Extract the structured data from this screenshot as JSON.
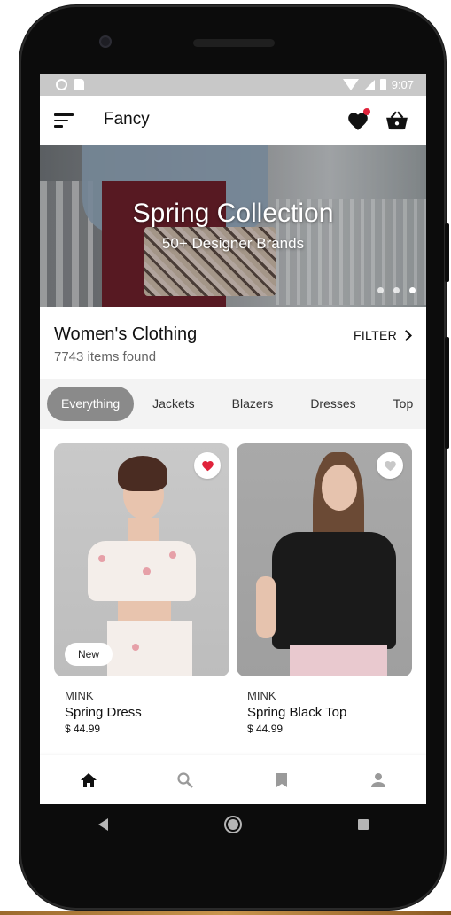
{
  "status_bar": {
    "time": "9:07"
  },
  "app_bar": {
    "title": "Fancy",
    "menu_icon": "menu-icon",
    "favorites_icon": "heart-icon",
    "cart_icon": "basket-icon"
  },
  "banner": {
    "title": "Spring Collection",
    "subtitle": "50+ Designer Brands",
    "slides": 3,
    "active_slide": 3
  },
  "category": {
    "title": "Women's Clothing",
    "count": "7743 items found",
    "filter_label": "FILTER"
  },
  "tabs": [
    {
      "label": "Everything",
      "active": true
    },
    {
      "label": "Jackets",
      "active": false
    },
    {
      "label": "Blazers",
      "active": false
    },
    {
      "label": "Dresses",
      "active": false
    },
    {
      "label": "Top",
      "active": false
    }
  ],
  "products": [
    {
      "brand": "MINK",
      "name": "Spring Dress",
      "price": "$ 44.99",
      "favorited": true,
      "badge": "New"
    },
    {
      "brand": "MINK",
      "name": "Spring Black Top",
      "price": "$ 44.99",
      "favorited": false,
      "badge": ""
    }
  ],
  "bottom_nav": [
    {
      "icon": "home-icon",
      "active": true
    },
    {
      "icon": "search-icon",
      "active": false
    },
    {
      "icon": "bookmark-icon",
      "active": false
    },
    {
      "icon": "person-icon",
      "active": false
    }
  ],
  "colors": {
    "accent_red": "#e0233b",
    "tab_active": "#8a8a8a",
    "icon_dark": "#111111",
    "nav_inactive": "#9a9a9a"
  }
}
